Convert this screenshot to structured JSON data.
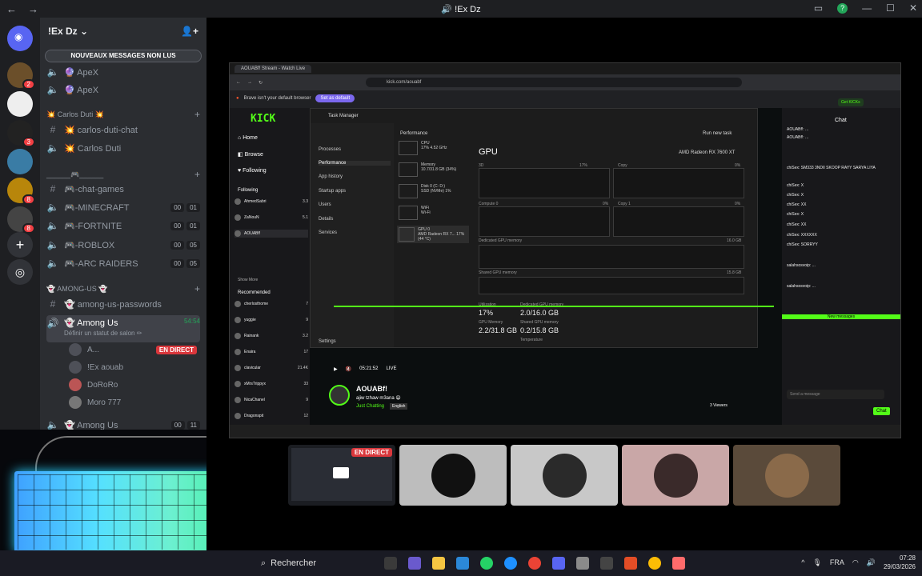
{
  "titlebar": {
    "title": "!Ex Dz",
    "back": "←",
    "forward": "→"
  },
  "rail": {
    "servers": [
      {
        "name": "server-1",
        "badge": "2",
        "color": "#6b4f2a"
      },
      {
        "name": "server-2",
        "badge": "",
        "color": "#eeeeee"
      },
      {
        "name": "server-3",
        "badge": "3",
        "color": "#222222"
      },
      {
        "name": "server-4",
        "badge": "",
        "color": "#3a7ca5"
      },
      {
        "name": "server-5",
        "badge": "8",
        "color": "#b8860b"
      },
      {
        "name": "server-6",
        "badge": "8",
        "color": "#444444"
      }
    ]
  },
  "sidebar": {
    "guild_name": "!Ex Dz",
    "new_messages": "NOUVEAUX MESSAGES NON LUS",
    "channels": [
      {
        "type": "voice",
        "label": "🔮 ApeX"
      },
      {
        "type": "voice",
        "label": "🔮 ApeX"
      },
      {
        "type": "category",
        "label": "💥 Carlos Duti 💥"
      },
      {
        "type": "text",
        "label": "💥 carlos-duti-chat"
      },
      {
        "type": "voice",
        "label": "💥 Carlos Duti"
      },
      {
        "type": "category",
        "label": "______🎮______"
      },
      {
        "type": "text",
        "label": "🎮-chat-games"
      },
      {
        "type": "voice",
        "label": "🎮-MINECRAFT",
        "counts": [
          "00",
          "01"
        ]
      },
      {
        "type": "voice",
        "label": "🎮-FORTNITE",
        "counts": [
          "00",
          "01"
        ]
      },
      {
        "type": "voice",
        "label": "🎮-ROBLOX",
        "counts": [
          "00",
          "05"
        ]
      },
      {
        "type": "voice",
        "label": "🎮-ARC RAIDERS",
        "counts": [
          "00",
          "05"
        ]
      },
      {
        "type": "category",
        "label": "👻 AMONG-US 👻"
      },
      {
        "type": "text",
        "label": "👻 among-us-passwords"
      }
    ],
    "active_channel": {
      "label": "👻 Among Us",
      "time": "54:54",
      "status": "Définir un statut de salon ✏"
    },
    "voice_users": [
      {
        "name": "A...",
        "live": "EN DIRECT"
      },
      {
        "name": "!Ex aouab"
      },
      {
        "name": "DoRoRo"
      },
      {
        "name": "Moro 777"
      }
    ],
    "last_channel": {
      "label": "👻 Among Us",
      "counts": [
        "00",
        "11"
      ]
    }
  },
  "browser": {
    "tab": "AOUABf! Stream - Watch Live",
    "url": "kick.com/aouabf",
    "info_text": "Brave isn't your default browser",
    "info_button": "Set as default"
  },
  "kick": {
    "logo": "KICK",
    "nav": [
      "Home",
      "Browse",
      "Following"
    ],
    "following_header": "Following",
    "following": [
      {
        "name": "AhmedSabri",
        "n": "3.3"
      },
      {
        "name": "ZaNouN",
        "n": "5.1"
      },
      {
        "name": "AOUABf!",
        "n": ""
      }
    ],
    "show_more": "Show More",
    "recommended_header": "Recommended",
    "recommended": [
      {
        "name": "cherlosthome",
        "n": "7"
      },
      {
        "name": "yuggie",
        "n": "9"
      },
      {
        "name": "Rainank",
        "n": "3.2"
      },
      {
        "name": "Enaira",
        "n": "17"
      },
      {
        "name": "clavicular",
        "n": "21.4K"
      },
      {
        "name": "xMrsTrippyx",
        "n": "33"
      },
      {
        "name": "NicaChanel",
        "n": "9"
      },
      {
        "name": "Dragonspit",
        "n": "12"
      }
    ],
    "player_time": "05:21:52",
    "player_live": "LIVE",
    "streamer": "AOUABf!",
    "stream_title": "ajiw tzhaw m3ana 😄",
    "category": "Just Chatting",
    "lang": "English",
    "viewers": "3 Viewers",
    "get_kicks": "Get KICKs",
    "chat_title": "Chat",
    "chat_lines": [
      "AOUABf!: ...",
      "AOUABf!: ...",
      "chiSex: SM333 3NDII SKOOP RAYY SARYA LIYA",
      "chiSex: X",
      "chiSex: X",
      "chiSex: XX",
      "chiSex: X",
      "chiSex: XX",
      "chiSex: XXXXXX",
      "chiSex: SORRYY",
      "salahsosvoip: ...",
      "salahsosvoip: ..."
    ],
    "new_messages": "New messages",
    "send_placeholder": "Send a message",
    "chat_button": "Chat"
  },
  "taskmanager": {
    "title": "Task Manager",
    "nav": [
      "Processes",
      "Performance",
      "App history",
      "Startup apps",
      "Users",
      "Details",
      "Services",
      "Settings"
    ],
    "section": "Performance",
    "run_task": "Run new task",
    "cards": [
      {
        "name": "CPU",
        "sub": "17% 4.52 GHz"
      },
      {
        "name": "Memory",
        "sub": "10.7/31.8 GB (34%)"
      },
      {
        "name": "Disk 0 (C: D:)",
        "sub": "SSD (NVMe) 1%"
      },
      {
        "name": "WiFi",
        "sub": "Wi-Fi"
      },
      {
        "name": "GPU 0",
        "sub": "AMD Radeon RX 7... 17% (44 °C)"
      }
    ],
    "gpu_title": "GPU",
    "gpu_model": "AMD Radeon RX 7600 XT",
    "graphs": [
      "3D",
      "Copy",
      "Compute 0",
      "Copy 1"
    ],
    "graph_pct": [
      "17%",
      "0%",
      "0%",
      "0%"
    ],
    "dedicated_label": "Dedicated GPU memory",
    "dedicated_max": "16.0 GB",
    "shared_label": "Shared GPU memory",
    "shared_max": "15.8 GB",
    "stats": [
      {
        "label": "Utilization",
        "value": "17%"
      },
      {
        "label": "Dedicated GPU memory",
        "value": "2.0/16.0 GB"
      },
      {
        "label": "GPU Memory",
        "value": "2.2/31.8 GB"
      },
      {
        "label": "Shared GPU memory",
        "value": "0.2/15.8 GB"
      },
      {
        "label": "Temperature",
        "value": "44 °C"
      }
    ]
  },
  "tiles": [
    {
      "name": "screen-share",
      "live": "EN DIRECT",
      "bg": "#1b1d22"
    },
    {
      "name": "user-tile-1",
      "bg": "#bdbdbd",
      "avatar": "#111111"
    },
    {
      "name": "user-tile-2",
      "bg": "#c8c8c8",
      "avatar": "#2a2a2a"
    },
    {
      "name": "user-tile-3",
      "bg": "#c9a7a7",
      "avatar": "#3a2a2a"
    },
    {
      "name": "user-tile-4",
      "bg": "#5a4a3a",
      "avatar": "#8a6a4a"
    }
  ],
  "taskbar": {
    "search": "Rechercher",
    "lang": "FRA",
    "time": "07:28",
    "date": "29/03/2026",
    "apps": [
      "#3a3a3a",
      "#6a5acd",
      "#f5c542",
      "#2b88d8",
      "#25d366",
      "#1e90ff",
      "#ea4335",
      "#5865f2",
      "#8a8a8a",
      "#444",
      "#e34d26",
      "#fbbc05",
      "#ff6b6b"
    ]
  }
}
